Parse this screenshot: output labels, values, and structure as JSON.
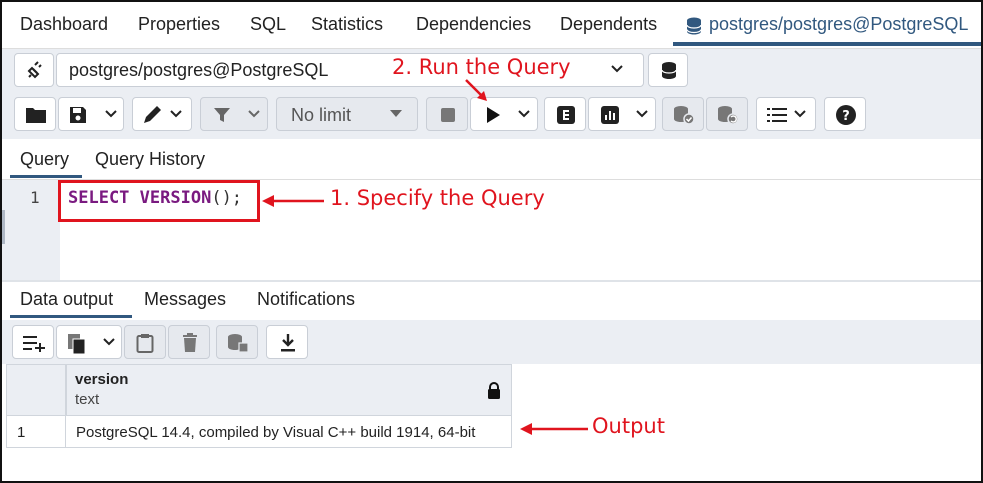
{
  "tabs": [
    {
      "label": "Dashboard"
    },
    {
      "label": "Properties"
    },
    {
      "label": "SQL"
    },
    {
      "label": "Statistics"
    },
    {
      "label": "Dependencies"
    },
    {
      "label": "Dependents"
    },
    {
      "label": "postgres/postgres@PostgreSQL"
    }
  ],
  "connection": {
    "value": "postgres/postgres@PostgreSQL"
  },
  "toolbar": {
    "limit_value": "No limit"
  },
  "query_tabs": [
    {
      "label": "Query"
    },
    {
      "label": "Query History"
    }
  ],
  "editor": {
    "line_number": "1",
    "keyword1": "SELECT",
    "keyword2": "VERSION",
    "punct": "();"
  },
  "annotations": {
    "specify": "1. Specify the Query",
    "run": "2. Run the Query",
    "output": "Output"
  },
  "output_tabs": [
    {
      "label": "Data output"
    },
    {
      "label": "Messages"
    },
    {
      "label": "Notifications"
    }
  ],
  "grid": {
    "column_name": "version",
    "column_type": "text",
    "rows": [
      {
        "num": "1",
        "value": "PostgreSQL 14.4, compiled by Visual C++ build 1914, 64-bit"
      }
    ]
  },
  "colors": {
    "accent": "#31587f",
    "annotation": "#e0141e",
    "keyword": "#7a1a80"
  },
  "icons": [
    "disconnect-icon",
    "db-icon",
    "folder-icon",
    "save-icon",
    "pen-icon",
    "filter-icon",
    "stop-icon",
    "play-icon",
    "explain-icon",
    "chart-icon",
    "commit-icon",
    "rollback-icon",
    "list-icon",
    "help-icon",
    "add-row-icon",
    "copy-icon",
    "paste-icon",
    "delete-icon",
    "save-data-icon",
    "download-icon",
    "lock-icon"
  ]
}
